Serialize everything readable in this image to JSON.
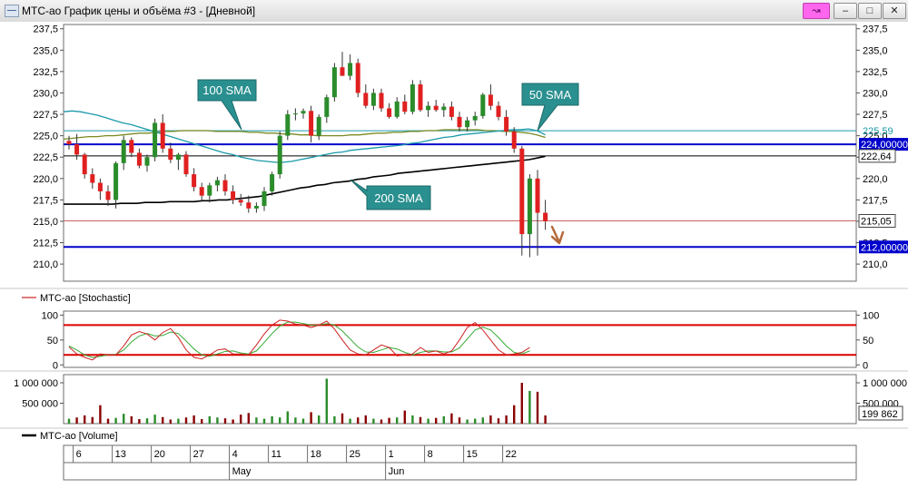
{
  "window": {
    "title": "МТС-ао График цены и объёма #3 - [Дневной]",
    "link_icon": "link-icon",
    "minimize_icon": "minimize-icon",
    "maximize_icon": "maximize-icon",
    "close_icon": "close-icon"
  },
  "colors": {
    "up": "#2a8c2a",
    "down": "#e02020",
    "sma50": "#1a9aaa",
    "sma100": "#7a8a20",
    "sma200": "#000000",
    "blue_level": "#0000cc",
    "red_level": "#c86060",
    "stoch_k": "#cc2222",
    "stoch_d": "#33aa33",
    "stoch_band": "#dd0000",
    "vol_up": "#2a8c2a",
    "vol_down": "#8b0000",
    "callout": "#2a8f8f",
    "arrow": "#b56a3a"
  },
  "chart_data": [
    {
      "type": "candlestick",
      "name": "price",
      "ylim": [
        208,
        238
      ],
      "y_ticks": [
        "237,5",
        "235,0",
        "232,5",
        "230,0",
        "227,5",
        "225,0",
        "222,5",
        "220,0",
        "217,5",
        "215,0",
        "212,5",
        "210,0"
      ],
      "candles": [
        [
          224.4,
          225.0,
          223.4,
          224.0
        ],
        [
          224.0,
          225.2,
          222.2,
          222.8
        ],
        [
          222.8,
          223.0,
          220.0,
          220.5
        ],
        [
          220.5,
          221.2,
          218.8,
          219.5
        ],
        [
          219.5,
          220.0,
          217.5,
          218.5
        ],
        [
          218.5,
          219.2,
          216.8,
          217.5
        ],
        [
          217.5,
          222.0,
          216.5,
          221.8
        ],
        [
          221.8,
          225.0,
          221.0,
          224.5
        ],
        [
          224.5,
          224.8,
          222.5,
          223.0
        ],
        [
          223.0,
          223.5,
          221.2,
          221.5
        ],
        [
          221.5,
          222.8,
          220.8,
          222.5
        ],
        [
          222.5,
          227.0,
          222.0,
          226.5
        ],
        [
          226.5,
          227.5,
          223.0,
          223.5
        ],
        [
          223.5,
          224.2,
          221.8,
          222.2
        ],
        [
          222.2,
          223.0,
          221.0,
          222.8
        ],
        [
          222.8,
          223.2,
          220.2,
          220.5
        ],
        [
          220.5,
          221.2,
          218.5,
          219.0
        ],
        [
          219.0,
          219.5,
          217.5,
          218.0
        ],
        [
          218.0,
          219.5,
          217.2,
          219.2
        ],
        [
          219.2,
          220.2,
          218.5,
          219.8
        ],
        [
          219.8,
          220.5,
          218.0,
          218.5
        ],
        [
          218.5,
          219.2,
          217.0,
          217.5
        ],
        [
          217.5,
          218.2,
          216.8,
          217.2
        ],
        [
          217.2,
          218.0,
          216.0,
          216.5
        ],
        [
          216.5,
          217.2,
          216.0,
          216.8
        ],
        [
          216.8,
          219.0,
          216.2,
          218.5
        ],
        [
          218.5,
          220.8,
          218.0,
          220.5
        ],
        [
          220.5,
          225.5,
          220.0,
          225.0
        ],
        [
          225.0,
          228.0,
          224.5,
          227.5
        ],
        [
          227.5,
          228.2,
          226.8,
          227.6
        ],
        [
          227.6,
          228.2,
          227.0,
          227.9
        ],
        [
          227.9,
          228.5,
          224.2,
          225.0
        ],
        [
          225.0,
          227.5,
          224.5,
          227.2
        ],
        [
          227.2,
          229.8,
          226.5,
          229.5
        ],
        [
          229.5,
          233.5,
          229.0,
          233.0
        ],
        [
          233.0,
          234.8,
          232.0,
          232.0
        ],
        [
          232.0,
          234.5,
          231.5,
          233.5
        ],
        [
          233.5,
          234.0,
          229.5,
          230.0
        ],
        [
          230.0,
          231.0,
          228.2,
          228.5
        ],
        [
          228.5,
          230.5,
          228.0,
          230.0
        ],
        [
          230.0,
          230.5,
          227.8,
          228.2
        ],
        [
          228.2,
          228.8,
          227.0,
          227.2
        ],
        [
          227.2,
          229.5,
          227.0,
          229.0
        ],
        [
          229.0,
          229.8,
          227.5,
          227.8
        ],
        [
          227.8,
          231.5,
          227.5,
          231.0
        ],
        [
          231.0,
          231.5,
          227.8,
          228.0
        ],
        [
          228.0,
          229.0,
          227.2,
          228.5
        ],
        [
          228.5,
          229.2,
          227.8,
          228.0
        ],
        [
          228.0,
          228.8,
          227.2,
          228.4
        ],
        [
          228.4,
          229.0,
          226.8,
          227.2
        ],
        [
          227.2,
          227.8,
          225.5,
          226.0
        ],
        [
          226.0,
          227.2,
          225.5,
          226.8
        ],
        [
          226.8,
          227.8,
          226.2,
          227.3
        ],
        [
          227.3,
          230.0,
          227.0,
          229.8
        ],
        [
          229.8,
          231.0,
          228.0,
          228.5
        ],
        [
          228.5,
          229.0,
          226.8,
          227.2
        ],
        [
          227.2,
          228.0,
          225.0,
          225.5
        ],
        [
          225.5,
          226.0,
          223.0,
          223.5
        ],
        [
          223.5,
          223.8,
          211.0,
          213.5
        ],
        [
          213.5,
          220.5,
          210.8,
          220.0
        ],
        [
          220.0,
          221.0,
          211.0,
          216.0
        ],
        [
          216.0,
          217.5,
          214.0,
          215.0
        ]
      ],
      "sma50": [
        227.8,
        227.9,
        227.8,
        227.6,
        227.4,
        227.1,
        226.8,
        226.5,
        226.3,
        226.0,
        225.7,
        225.4,
        225.1,
        224.8,
        224.5,
        224.2,
        223.9,
        223.6,
        223.3,
        223.0,
        222.8,
        222.5,
        222.3,
        222.1,
        222.0,
        221.9,
        221.9,
        222.0,
        222.2,
        222.4,
        222.6,
        222.8,
        223.0,
        223.1,
        223.3,
        223.4,
        223.5,
        223.6,
        223.7,
        223.8,
        223.9,
        224.1,
        224.2,
        224.4,
        224.6,
        224.8,
        224.9,
        225.1,
        225.2,
        225.3,
        225.4,
        225.5,
        225.6,
        225.7,
        225.7,
        225.8,
        225.6,
        225.1
      ],
      "sma100": [
        224.6,
        224.7,
        224.8,
        224.9,
        224.9,
        225.0,
        225.0,
        225.1,
        225.2,
        225.3,
        225.3,
        225.4,
        225.5,
        225.5,
        225.6,
        225.6,
        225.6,
        225.6,
        225.5,
        225.5,
        225.5,
        225.5,
        225.4,
        225.4,
        225.3,
        225.3,
        225.2,
        225.2,
        225.1,
        225.1,
        225.0,
        225.0,
        225.0,
        225.0,
        225.1,
        225.1,
        225.2,
        225.3,
        225.3,
        225.4,
        225.4,
        225.5,
        225.5,
        225.6,
        225.6,
        225.7,
        225.7,
        225.7,
        225.7,
        225.7,
        225.6,
        225.6,
        225.5,
        225.5,
        225.4,
        225.3,
        225.1,
        224.8
      ],
      "sma200": [
        217.0,
        217.0,
        217.0,
        217.0,
        217.0,
        217.0,
        217.0,
        217.1,
        217.1,
        217.1,
        217.2,
        217.2,
        217.2,
        217.3,
        217.3,
        217.3,
        217.3,
        217.4,
        217.4,
        217.5,
        217.5,
        217.6,
        217.7,
        217.8,
        217.9,
        218.1,
        218.3,
        218.5,
        218.7,
        218.9,
        219.0,
        219.2,
        219.3,
        219.5,
        219.6,
        219.7,
        219.9,
        220.0,
        220.2,
        220.3,
        220.4,
        220.6,
        220.7,
        220.8,
        220.9,
        221.0,
        221.1,
        221.2,
        221.3,
        221.4,
        221.5,
        221.6,
        221.7,
        221.8,
        221.9,
        222.0,
        222.1,
        222.2,
        222.4,
        222.6
      ],
      "levels": [
        {
          "y": 224.0,
          "label": "224,00000",
          "kind": "blue"
        },
        {
          "y": 212.0,
          "label": "212,00000",
          "kind": "blue"
        },
        {
          "y": 222.64,
          "label": "222,64",
          "kind": "black"
        },
        {
          "y": 215.05,
          "label": "215,05",
          "kind": "red"
        },
        {
          "y": 225.59,
          "label": "225,59",
          "kind": "teal"
        }
      ],
      "annotations": [
        "100 SMA",
        "50 SMA",
        "200 SMA"
      ]
    },
    {
      "type": "line",
      "name": "stochastic",
      "legend": "МТС-ао [Stochastic]",
      "ylim": [
        -5,
        108
      ],
      "y_ticks": [
        "100",
        "50",
        "0"
      ],
      "bands": [
        80,
        20
      ],
      "k": [
        36,
        22,
        15,
        10,
        22,
        20,
        20,
        38,
        60,
        67,
        62,
        50,
        65,
        73,
        55,
        30,
        15,
        12,
        20,
        30,
        32,
        22,
        22,
        20,
        40,
        62,
        80,
        90,
        88,
        82,
        80,
        75,
        80,
        88,
        72,
        50,
        30,
        22,
        20,
        30,
        40,
        35,
        18,
        20,
        22,
        35,
        25,
        28,
        22,
        28,
        50,
        75,
        85,
        70,
        50,
        30,
        20,
        22,
        25,
        35
      ],
      "d": [
        38,
        30,
        20,
        15,
        17,
        20,
        21,
        30,
        46,
        58,
        63,
        58,
        59,
        66,
        63,
        48,
        32,
        20,
        17,
        22,
        27,
        28,
        24,
        22,
        28,
        45,
        63,
        78,
        86,
        86,
        83,
        80,
        80,
        83,
        80,
        68,
        52,
        36,
        26,
        25,
        30,
        35,
        32,
        25,
        20,
        25,
        28,
        28,
        26,
        26,
        34,
        52,
        70,
        76,
        70,
        55,
        38,
        25,
        22,
        28
      ]
    },
    {
      "type": "bar",
      "name": "volume",
      "legend": "МТС-ао [Volume]",
      "ylim": [
        0,
        1200000
      ],
      "y_ticks": [
        "1 000 000",
        "500 000"
      ],
      "last_value": "199 862",
      "values": [
        120000,
        150000,
        200000,
        160000,
        450000,
        120000,
        140000,
        240000,
        180000,
        110000,
        130000,
        220000,
        160000,
        100000,
        120000,
        150000,
        200000,
        110000,
        180000,
        150000,
        130000,
        100000,
        220000,
        260000,
        150000,
        120000,
        180000,
        150000,
        300000,
        150000,
        120000,
        280000,
        200000,
        1100000,
        180000,
        250000,
        120000,
        150000,
        200000,
        120000,
        100000,
        140000,
        150000,
        320000,
        200000,
        160000,
        120000,
        140000,
        180000,
        250000,
        150000,
        100000,
        120000,
        150000,
        200000,
        130000,
        200000,
        450000,
        1000000,
        800000,
        780000,
        200000
      ],
      "up": [
        1,
        0,
        0,
        0,
        0,
        0,
        1,
        1,
        0,
        0,
        1,
        1,
        0,
        0,
        1,
        0,
        0,
        0,
        1,
        1,
        0,
        0,
        0,
        0,
        1,
        1,
        1,
        1,
        1,
        1,
        1,
        0,
        1,
        1,
        1,
        0,
        1,
        0,
        0,
        1,
        0,
        0,
        1,
        0,
        1,
        0,
        1,
        0,
        1,
        0,
        0,
        1,
        1,
        1,
        0,
        0,
        0,
        0,
        0,
        1,
        0,
        0
      ]
    }
  ],
  "date_axis": {
    "days": [
      "6",
      "13",
      "20",
      "27",
      "4",
      "11",
      "18",
      "25",
      "1",
      "8",
      "15",
      "22"
    ],
    "months": [
      "May",
      "Jun"
    ]
  }
}
